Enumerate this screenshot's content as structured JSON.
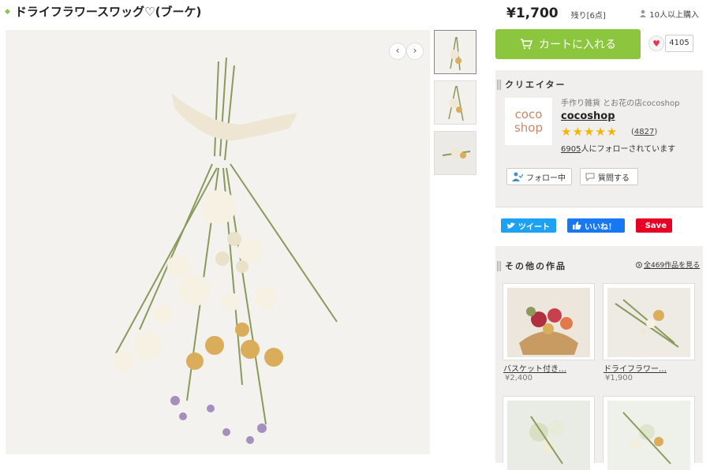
{
  "product": {
    "title": "ドライフラワースワッグ♡(ブーケ)",
    "price": "¥1,700",
    "stock": "残り[6点]",
    "bought": "10人以上購入",
    "cart_label": "カートに入れる",
    "favorites": "4105"
  },
  "creator": {
    "section_title": "クリエイター",
    "logo_line1": "coco",
    "logo_line2": "shop",
    "subtitle": "手作り雑貨 とお花の店cocoshop",
    "name": "cocoshop",
    "stars": "★★★★★",
    "reviews_open": "(",
    "reviews": "4827",
    "reviews_close": ")",
    "followers": "6905",
    "followers_suffix": "人にフォローされています",
    "follow_label": "フォロー中",
    "question_label": "質問する"
  },
  "share": {
    "tweet": "ツイート",
    "like": "いいね！",
    "save": "Save"
  },
  "other_works": {
    "section_title": "その他の作品",
    "see_all": "全469作品を見る",
    "items": [
      {
        "title": "バスケット付き…",
        "price": "¥2,400"
      },
      {
        "title": "ドライフラワー…",
        "price": "¥1,900"
      },
      {
        "title": "",
        "price": ""
      },
      {
        "title": "",
        "price": ""
      }
    ]
  },
  "icons": {
    "prev": "‹",
    "next": "›",
    "heart": "♥"
  },
  "colors": {
    "cart_green": "#8cc63f",
    "twitter": "#1da1f2",
    "facebook": "#1877f2",
    "pinterest": "#e60023"
  }
}
